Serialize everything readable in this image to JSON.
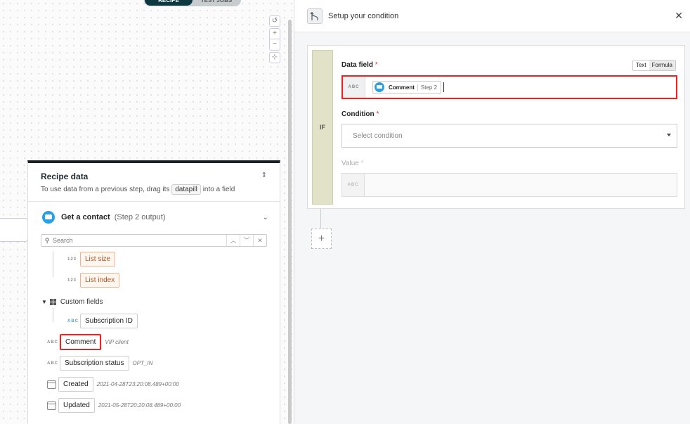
{
  "canvas": {
    "tabs": [
      {
        "label": "Recipe",
        "active": true
      },
      {
        "label": "Test jobs",
        "active": false
      }
    ],
    "zoom_controls": [
      "↺",
      "+",
      "−",
      "⊹"
    ]
  },
  "recipe_data": {
    "title": "Recipe data",
    "subtitle_before": "To use data from a previous step, drag its",
    "subtitle_pill": "datapill",
    "subtitle_after": "into a field",
    "step": {
      "title": "Get a contact",
      "meta": "(Step 2 output)",
      "icon": "chat-bubble-icon"
    },
    "search": {
      "placeholder": "Search"
    },
    "items": [
      {
        "type": "123",
        "label": "List size"
      },
      {
        "type": "123",
        "label": "List index"
      },
      {
        "group": "Custom fields"
      },
      {
        "type": "ABC",
        "label": "Subscription ID"
      },
      {
        "type": "ABC",
        "label": "Comment",
        "value": "VIP client"
      },
      {
        "type": "ABC",
        "label": "Subscription status",
        "value": "OPT_IN"
      },
      {
        "type": "date",
        "label": "Created",
        "value": "2021-04-28T23:20:08.489+00:00"
      },
      {
        "type": "date",
        "label": "Updated",
        "value": "2021-05-28T20:20:08.489+00:00"
      }
    ]
  },
  "condition_panel": {
    "title": "Setup your condition",
    "if_label": "IF",
    "data_field": {
      "label": "Data field",
      "required_mark": "*",
      "type_tag": "ABC",
      "mode_toggle": [
        "Text",
        "Formula"
      ],
      "pill_name": "Comment",
      "pill_step": "Step 2"
    },
    "condition": {
      "label": "Condition",
      "required_mark": "*",
      "placeholder": "Select condition"
    },
    "value": {
      "label": "Value",
      "required_mark": "*",
      "type_tag": "ABC"
    },
    "add_step": "+"
  },
  "colors": {
    "highlight": "#e22222",
    "brand_dark": "#0d3a40",
    "list_orange": "#b4541e",
    "step_icon": "#28a0e8"
  }
}
